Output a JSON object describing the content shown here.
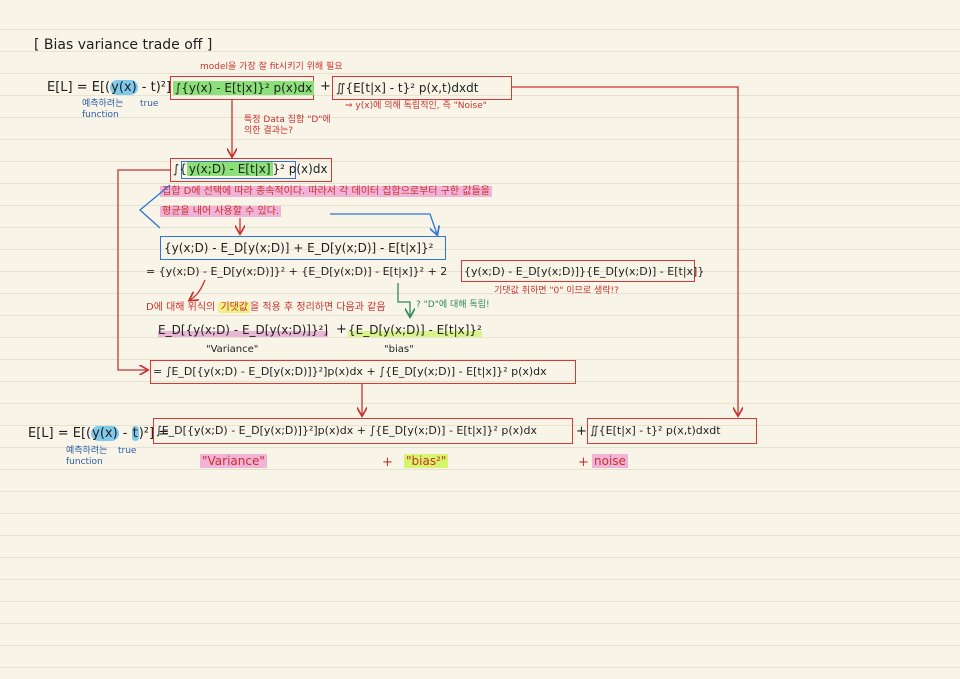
{
  "title": "Bias  variance  trade off",
  "eq1": {
    "lhs": "E[L] = E[(",
    "yx": "y(x)",
    "minus_t": " - t",
    "close_sq": ")²] = ",
    "term1": "∫{y(x) - E[t|x]}² p(x)dx",
    "plus": "+",
    "term2": "∬{E[t|x] - t}² p(x,t)dxdt",
    "annot_red_top": "model을 가장 잘 fit시키기 위해 필요",
    "annot_yx": "예측하려는 function",
    "annot_true": "true",
    "annot_noise": "⇒ y(x)에 의해 독립적인, 즉 \"Noise\""
  },
  "q_dataset": "특정 Data 집합 \"D\"에 의한 결과는?",
  "eq2": {
    "integral": "∫{",
    "inner": "y(x;D) - E[t|x]",
    "tail": "}² p(x)dx"
  },
  "note_blue": {
    "line1": "집합 D에 선택에 따라 종속적이다. 따라서 각 데이터 집합으로부터 구한 값들을",
    "line2": "평균을 내어 사용할 수 있다."
  },
  "eq3": {
    "expr": "{y(x;D) - E_D[y(x;D)] + E_D[y(x;D)] - E[t|x]}²"
  },
  "eq4": {
    "prefix": "= {y(x;D) - E_D[y(x;D)]}² + {E_D[y(x;D)] - E[t|x]}² + 2",
    "boxed": "{y(x;D) - E_D[y(x;D)]}{E_D[y(x;D)] - E[t|x]}",
    "annot_zero": "기댓값 취하면 \"0\" 이므로 생략!?",
    "annot_green": "? \"D\"에 대해 독립!"
  },
  "note_red2": {
    "before": "D에 대해 위식의 ",
    "highlight": "기댓값",
    "after": "을 적용 후 정리하면 다음과 같음"
  },
  "eq5": {
    "variance_expr": "E_D[{y(x;D) - E_D[y(x;D)]}²]",
    "plus": "+",
    "bias_expr": "{E_D[y(x;D)] - E[t|x]}²",
    "variance_label": "\"Variance\"",
    "bias_label": "\"bias\""
  },
  "eq6": {
    "expr": "= ∫E_D[{y(x;D) - E_D[y(x;D)]}²]p(x)dx + ∫{E_D[y(x;D)] - E[t|x]}² p(x)dx"
  },
  "eq7": {
    "lhs": "E[L] = E[(",
    "yx": "y(x)",
    "minus": " - ",
    "t": "t",
    "close_sq": ")²] = ",
    "main": "∫E_D[{y(x;D) - E_D[y(x;D)]}²]p(x)dx + ∫{E_D[y(x;D)] - E[t|x]}² p(x)dx",
    "plus": "+",
    "noise_expr": "∬{E[t|x] - t}² p(x,t)dxdt",
    "annot_yx": "예측하려는 function",
    "annot_true": "true"
  },
  "bottom": {
    "variance": "\"Variance\"",
    "plus1": "+",
    "bias": "\"bias²\"",
    "plus2": "+",
    "noise": "noise"
  },
  "colors": {
    "red": "#c8322e",
    "blue": "#2d5ea8",
    "green": "#2c8a57",
    "paper": "#f8f5e8"
  }
}
